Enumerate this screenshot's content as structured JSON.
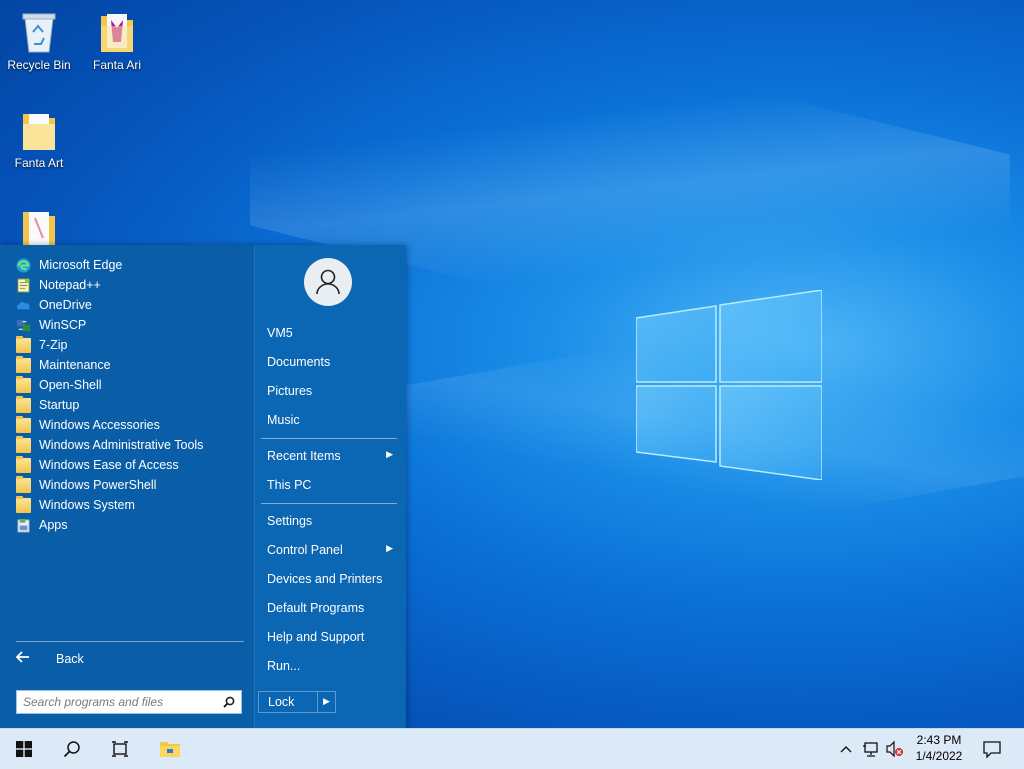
{
  "desktop": {
    "icons": [
      {
        "label": "Recycle Bin",
        "icon": "recycle-bin-icon"
      },
      {
        "label": "Fanta Ari",
        "icon": "folder-image-icon"
      },
      {
        "label": "Fanta Art",
        "icon": "folder-icon"
      },
      {
        "label": "",
        "icon": "folder-icon"
      }
    ]
  },
  "start_menu": {
    "programs": [
      {
        "label": "Microsoft Edge",
        "icon": "edge-icon"
      },
      {
        "label": "Notepad++",
        "icon": "notepadpp-icon"
      },
      {
        "label": "OneDrive",
        "icon": "onedrive-icon"
      },
      {
        "label": "WinSCP",
        "icon": "winscp-icon"
      },
      {
        "label": "7-Zip",
        "icon": "folder-icon"
      },
      {
        "label": "Maintenance",
        "icon": "folder-icon"
      },
      {
        "label": "Open-Shell",
        "icon": "folder-icon"
      },
      {
        "label": "Startup",
        "icon": "folder-icon"
      },
      {
        "label": "Windows Accessories",
        "icon": "folder-icon"
      },
      {
        "label": "Windows Administrative Tools",
        "icon": "folder-icon"
      },
      {
        "label": "Windows Ease of Access",
        "icon": "folder-icon"
      },
      {
        "label": "Windows PowerShell",
        "icon": "folder-icon"
      },
      {
        "label": "Windows System",
        "icon": "folder-icon"
      },
      {
        "label": "Apps",
        "icon": "apps-icon"
      }
    ],
    "back_label": "Back",
    "search_placeholder": "Search programs and files",
    "user_items": [
      {
        "label": "VM5"
      },
      {
        "label": "Documents"
      },
      {
        "label": "Pictures"
      },
      {
        "label": "Music"
      }
    ],
    "places_items": [
      {
        "label": "Recent Items",
        "submenu": true
      },
      {
        "label": "This PC",
        "submenu": false
      }
    ],
    "system_items": [
      {
        "label": "Settings",
        "submenu": false
      },
      {
        "label": "Control Panel",
        "submenu": true
      },
      {
        "label": "Devices and Printers",
        "submenu": false
      },
      {
        "label": "Default Programs",
        "submenu": false
      },
      {
        "label": "Help and Support",
        "submenu": false
      },
      {
        "label": "Run...",
        "submenu": false
      }
    ],
    "lock_label": "Lock"
  },
  "taskbar": {
    "clock_time": "2:43 PM",
    "clock_date": "1/4/2022"
  },
  "colors": {
    "start_menu_bg": "#0a5ea8",
    "taskbar_bg": "#dce9f7",
    "folder_yellow": "#f3c64b"
  }
}
